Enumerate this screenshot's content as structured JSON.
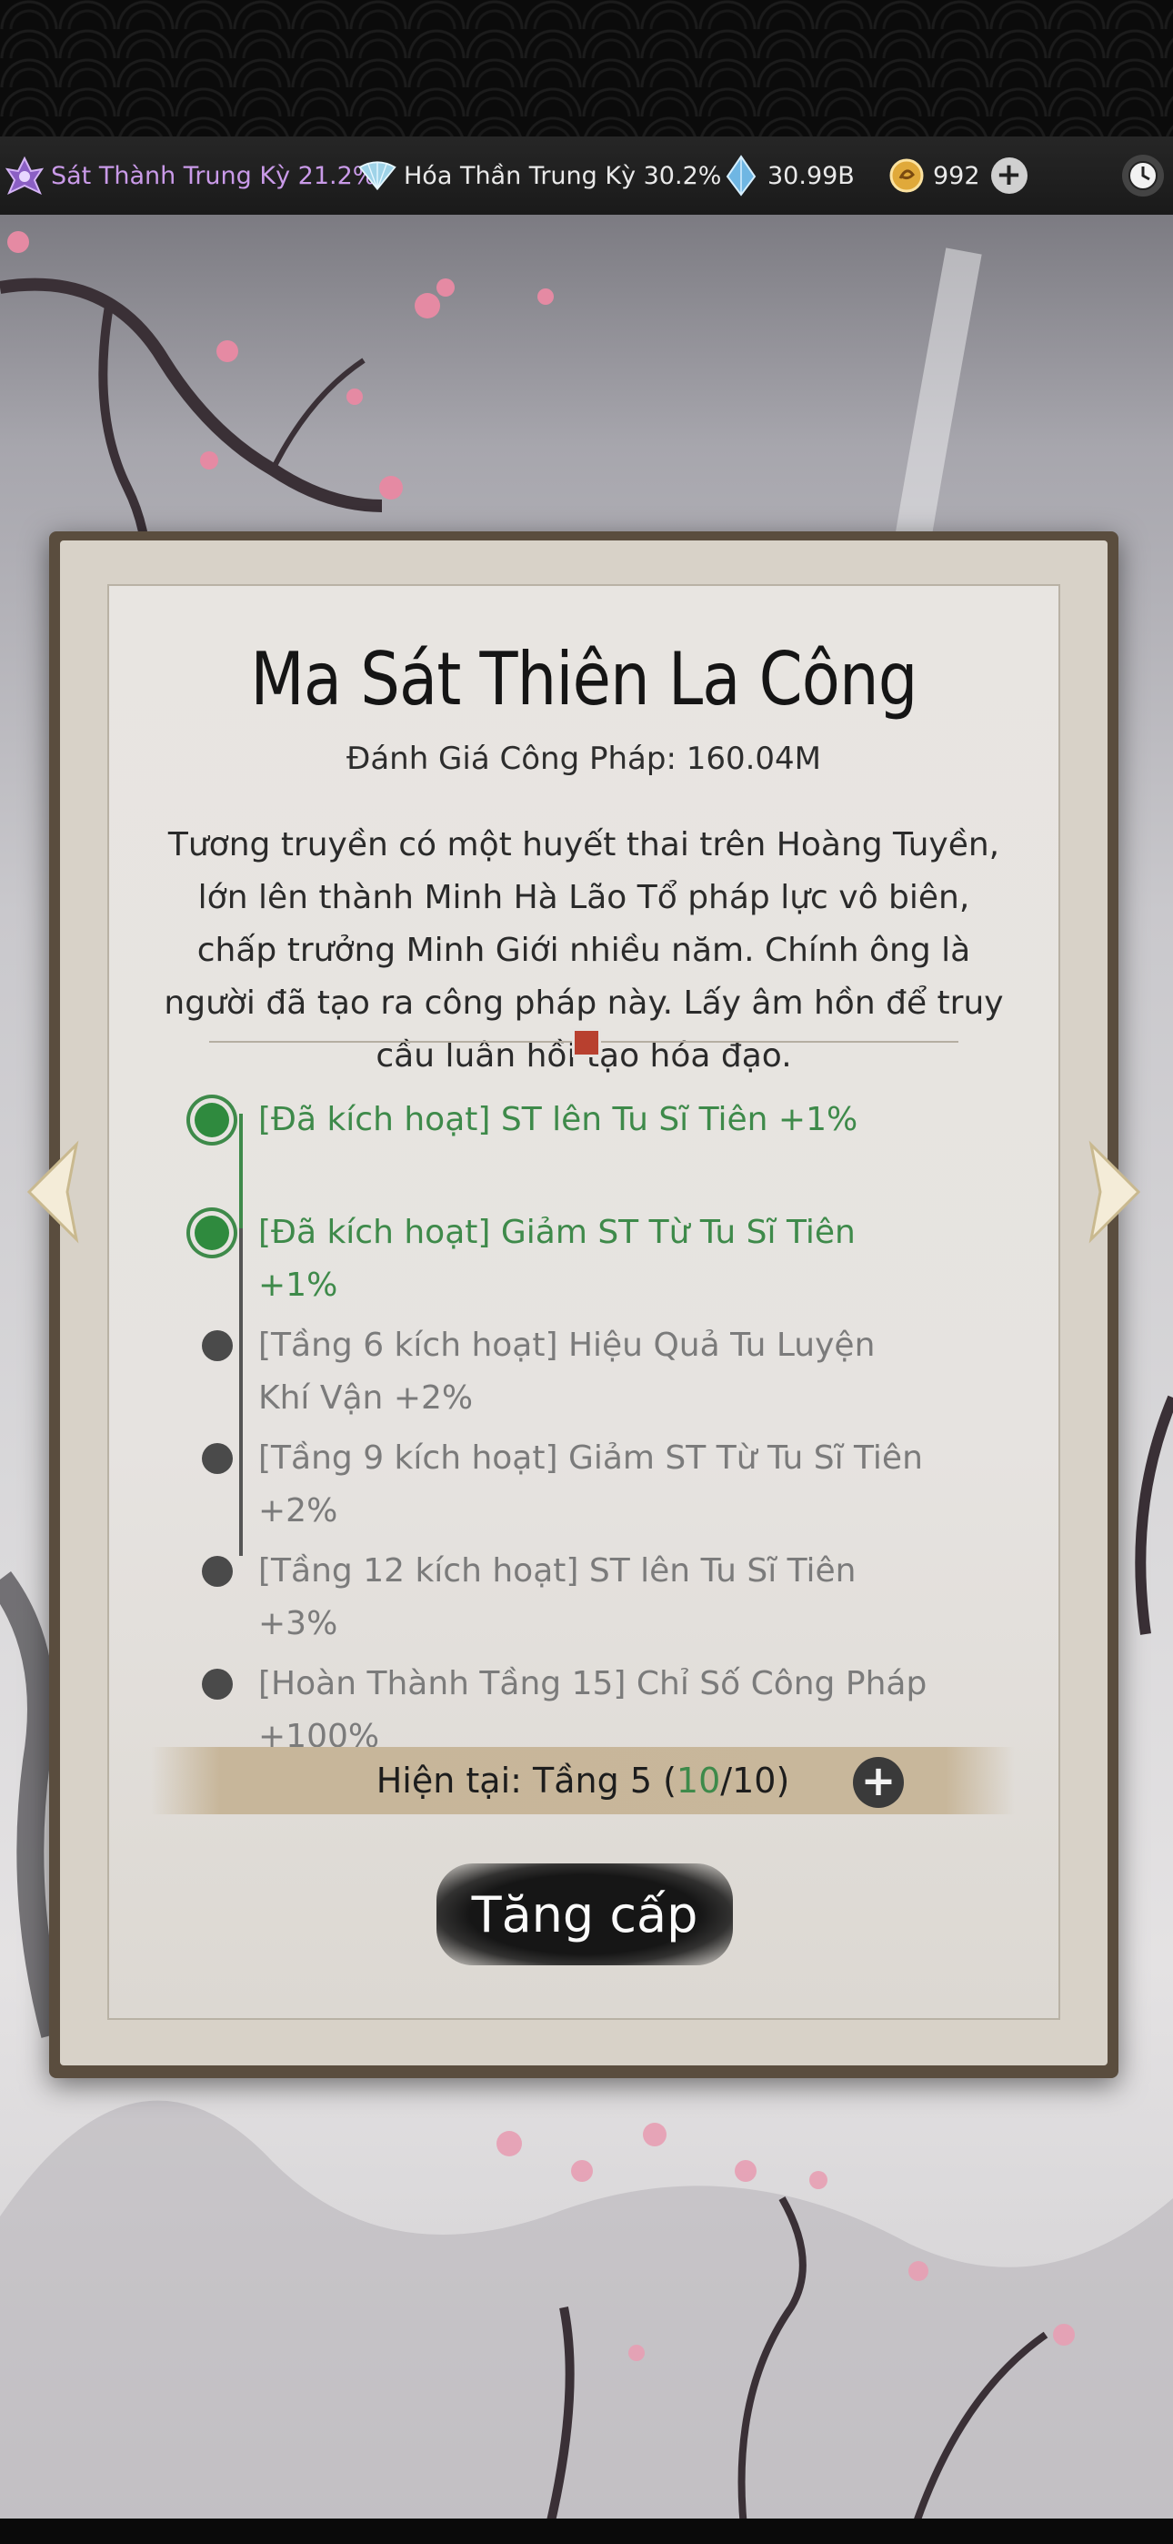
{
  "resources": {
    "rank1_label": "Sát Thành Trung Kỳ 21.2%",
    "rank2_label": "Hóa Thần Trung Kỳ 30.2%",
    "spirit_stones": "30.99B",
    "gold": "992"
  },
  "technique": {
    "name": "Ma Sát Thiên La Công",
    "rating": "Đánh Giá Công Pháp: 160.04M",
    "description": "Tương truyền có một huyết thai trên Hoàng Tuyền, lớn lên thành Minh Hà Lão Tổ pháp lực vô biên, chấp trưởng Minh Giới nhiều năm. Chính ông là người đã tạo ra công pháp này. Lấy âm hồn để truy cầu luân hồi tạo hóa đạo."
  },
  "effects": [
    {
      "text": "[Đã kích hoạt] ST lên Tu Sĩ Tiên +1%",
      "active": true
    },
    {
      "text": "[Đã kích hoạt] Giảm ST Từ Tu Sĩ Tiên +1%",
      "active": true
    },
    {
      "text": "[Tầng 6 kích hoạt] Hiệu Quả Tu Luyện Khí Vận +2%",
      "active": false
    },
    {
      "text": "[Tầng 9 kích hoạt] Giảm ST Từ Tu Sĩ Tiên +2%",
      "active": false
    },
    {
      "text": "[Tầng 12 kích hoạt] ST lên Tu Sĩ Tiên +3%",
      "active": false
    },
    {
      "text": "[Hoàn Thành Tầng 15] Chỉ Số Công Pháp +100%",
      "active": false
    }
  ],
  "level": {
    "prefix": "Hiện tại: Tầng 5 (",
    "current": "10",
    "separator": "/",
    "max": "10",
    "suffix": ")"
  },
  "upgrade_label": "Tăng cấp",
  "colors": {
    "active_green": "#3e8a4a",
    "inactive_gray": "#7b7b7b",
    "rank1_purple": "#c99ae8"
  },
  "icons": [
    "rank-demon-icon",
    "rank-fan-icon",
    "spirit-stone-icon",
    "gold-coin-icon",
    "plus-icon",
    "clock-icon",
    "left-arrow-icon",
    "right-arrow-icon"
  ]
}
